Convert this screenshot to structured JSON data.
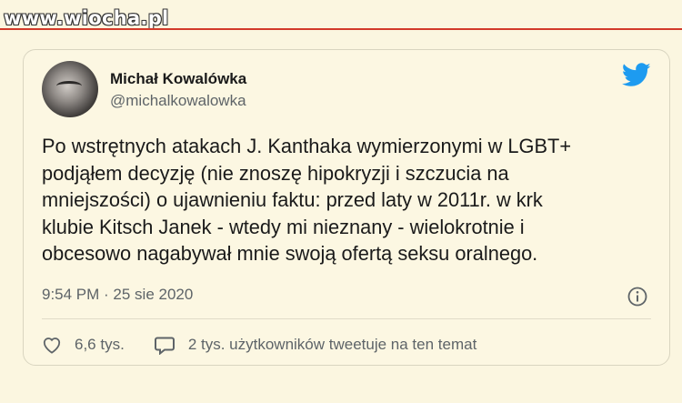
{
  "watermark": {
    "text": "www.wiocha.pl"
  },
  "tweet": {
    "author_name": "Michał Kowalówka",
    "handle": "@michalkowalowka",
    "lines": [
      "Po wstrętnych atakach J. Kanthaka wymierzonymi w LGBT+",
      "podjąłem decyzję (nie znoszę hipokryzji i szczucia na",
      "mniejszości) o ujawnieniu faktu: przed laty w 2011r. w krk",
      "klubie Kitsch Janek - wtedy mi nieznany - wielokrotnie i",
      "obcesowo nagabywał mnie swoją ofertą seksu oralnego."
    ],
    "timestamp": "9:54 PM · 25 sie 2020",
    "likes": "6,6 tys.",
    "conversation": "2 tys. użytkowników tweetuje na ten temat"
  },
  "icons": {
    "brand": "twitter-bird-icon",
    "info": "info-icon",
    "like": "heart-icon",
    "reply": "speech-bubble-icon"
  },
  "colors": {
    "background": "#fbf6e0",
    "accent_line": "#d23a2a",
    "twitter_blue": "#1d9bf0",
    "text": "#1a1a1a",
    "muted": "#5e6468"
  }
}
